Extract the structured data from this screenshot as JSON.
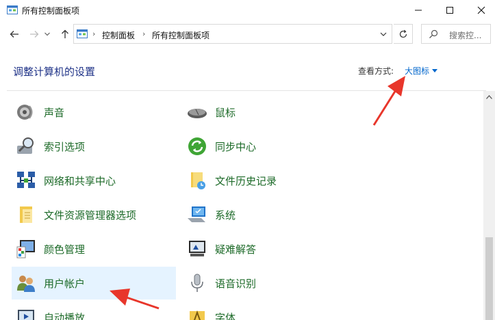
{
  "window": {
    "title": "所有控制面板项",
    "min_icon": "minimize-icon",
    "max_icon": "maximize-icon",
    "close_icon": "close-icon"
  },
  "address": {
    "crumbs": [
      "控制面板",
      "所有控制面板项"
    ],
    "search_placeholder": "搜索控..."
  },
  "content": {
    "heading": "调整计算机的设置",
    "view_by_label": "查看方式:",
    "view_by_value": "大图标"
  },
  "items": [
    {
      "label": "声音",
      "icon": "speaker-icon"
    },
    {
      "label": "鼠标",
      "icon": "mouse-icon"
    },
    {
      "label": "索引选项",
      "icon": "index-search-icon"
    },
    {
      "label": "同步中心",
      "icon": "sync-icon"
    },
    {
      "label": "网络和共享中心",
      "icon": "network-icon"
    },
    {
      "label": "文件历史记录",
      "icon": "file-history-icon"
    },
    {
      "label": "文件资源管理器选项",
      "icon": "folder-options-icon"
    },
    {
      "label": "系统",
      "icon": "system-monitor-icon"
    },
    {
      "label": "颜色管理",
      "icon": "color-management-icon"
    },
    {
      "label": "疑难解答",
      "icon": "troubleshoot-icon"
    },
    {
      "label": "用户帐户",
      "icon": "user-accounts-icon"
    },
    {
      "label": "语音识别",
      "icon": "microphone-icon"
    },
    {
      "label": "自动播放",
      "icon": "autoplay-icon"
    },
    {
      "label": "字体",
      "icon": "fonts-icon"
    }
  ],
  "colors": {
    "link_green": "#1c6a28",
    "heading_blue": "#1e3287",
    "accent_blue": "#0066cc",
    "selection": "#e5f3ff",
    "annotation_red": "#e8362b"
  }
}
